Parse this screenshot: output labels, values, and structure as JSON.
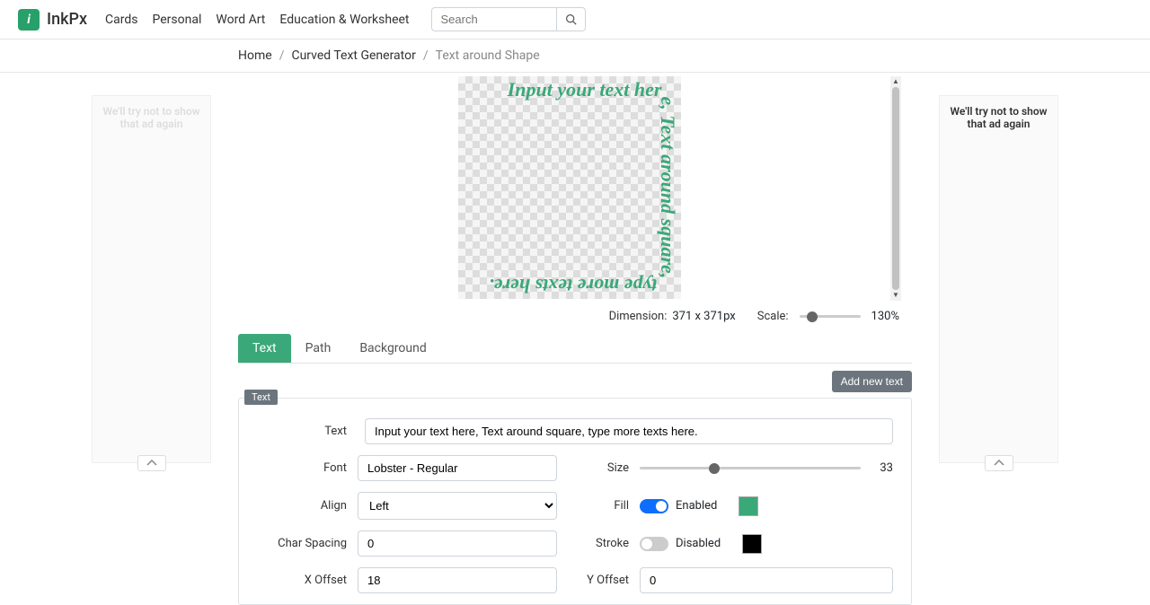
{
  "header": {
    "brand": "InkPx",
    "nav": [
      "Cards",
      "Personal",
      "Word Art",
      "Education & Worksheet"
    ],
    "search_placeholder": "Search"
  },
  "breadcrumb": {
    "items": [
      "Home",
      "Curved Text Generator"
    ],
    "current": "Text around Shape"
  },
  "ads": {
    "left": "We'll try not to show that ad again",
    "right": "We'll try not to show that ad again"
  },
  "canvas": {
    "preview_text": "Input your text here, Text around square, type more texts here.",
    "dimension_label": "Dimension:",
    "dimension_value": "371 x 371px",
    "scale_label": "Scale:",
    "scale_value": "130%"
  },
  "tabs": [
    "Text",
    "Path",
    "Background"
  ],
  "buttons": {
    "add_new_text": "Add new text"
  },
  "panel": {
    "tag": "Text",
    "fields": {
      "text_label": "Text",
      "text_value": "Input your text here, Text around square, type more texts here.",
      "font_label": "Font",
      "font_value": "Lobster - Regular",
      "size_label": "Size",
      "size_value": "33",
      "align_label": "Align",
      "align_value": "Left",
      "fill_label": "Fill",
      "fill_state": "Enabled",
      "fill_color": "#3aa878",
      "char_spacing_label": "Char Spacing",
      "char_spacing_value": "0",
      "stroke_label": "Stroke",
      "stroke_state": "Disabled",
      "stroke_color": "#000000",
      "xoffset_label": "X Offset",
      "xoffset_value": "18",
      "yoffset_label": "Y Offset",
      "yoffset_value": "0"
    }
  }
}
